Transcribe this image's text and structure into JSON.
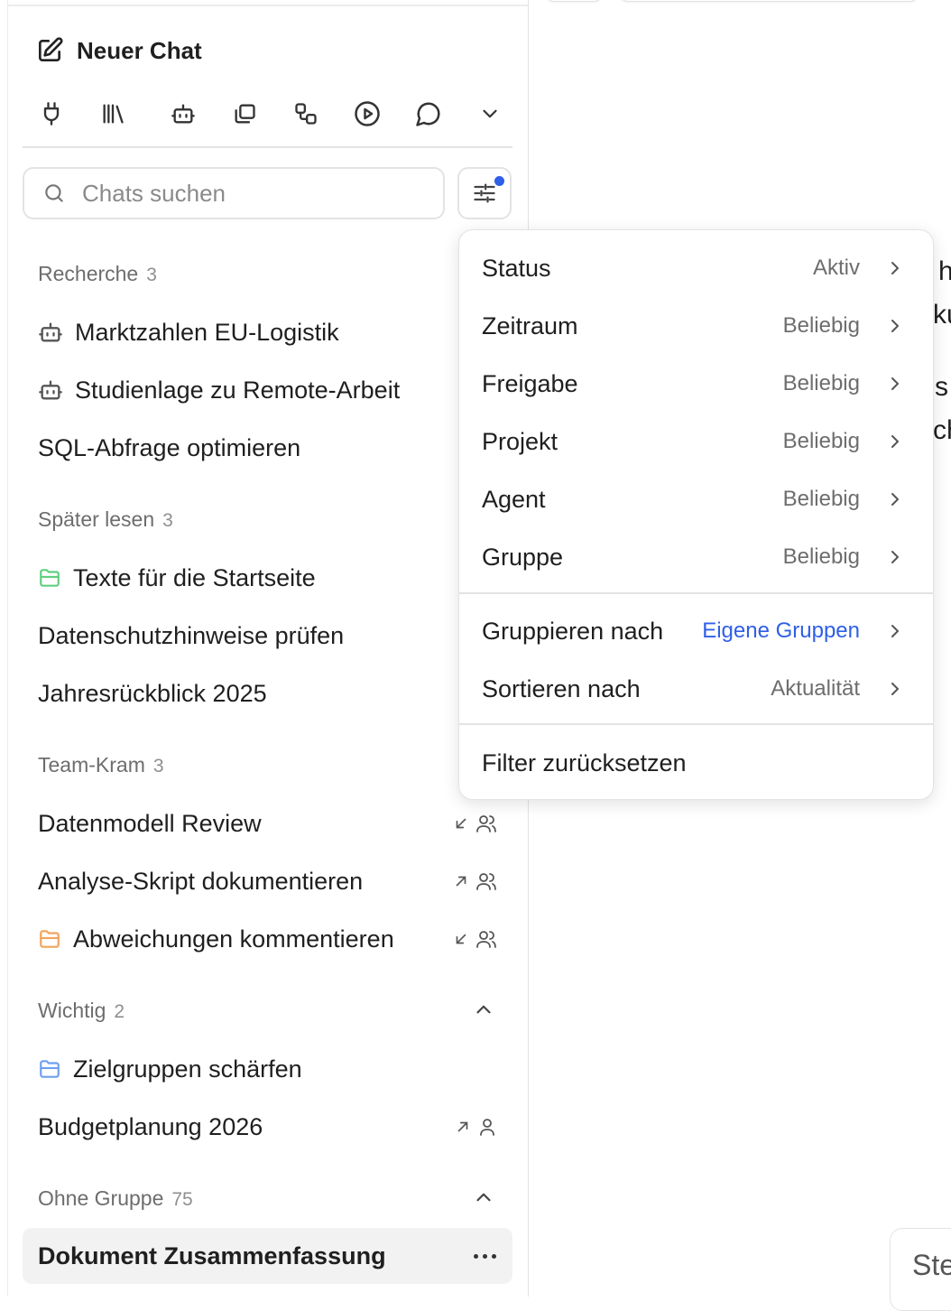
{
  "sidebar": {
    "new_chat": "Neuer Chat",
    "toolbar_icons": [
      "plug-icon",
      "library-icon",
      "bot-icon",
      "copy-icon",
      "workflow-icon",
      "play-icon",
      "message-icon",
      "chevron-down-icon"
    ],
    "search_placeholder": "Chats suchen",
    "groups": [
      {
        "name": "Recherche",
        "count": "3",
        "items": [
          {
            "label": "Marktzahlen EU-Logistik",
            "icon": "bot-icon"
          },
          {
            "label": "Studienlage zu Remote-Arbeit",
            "icon": "bot-icon"
          },
          {
            "label": "SQL-Abfrage optimieren"
          }
        ]
      },
      {
        "name": "Später lesen",
        "count": "3",
        "items": [
          {
            "label": "Texte für die Startseite",
            "icon": "folder-icon",
            "icon_color": "#5fcf7f"
          },
          {
            "label": "Datenschutzhinweise prüfen"
          },
          {
            "label": "Jahresrückblick 2025"
          }
        ]
      },
      {
        "name": "Team-Kram",
        "count": "3",
        "items": [
          {
            "label": "Datenmodell Review",
            "badges": [
              "arrow-down-left-icon",
              "users-icon"
            ]
          },
          {
            "label": "Analyse-Skript dokumentieren",
            "badges": [
              "arrow-up-right-icon",
              "users-icon"
            ]
          },
          {
            "label": "Abweichungen kommentieren",
            "icon": "folder-icon",
            "icon_color": "#f3a35a",
            "badges": [
              "arrow-down-left-icon",
              "users-icon"
            ]
          }
        ]
      },
      {
        "name": "Wichtig",
        "count": "2",
        "items": [
          {
            "label": "Zielgruppen schärfen",
            "icon": "folder-icon",
            "icon_color": "#6f9ff2"
          },
          {
            "label": "Budgetplanung 2026",
            "badges": [
              "arrow-up-right-icon",
              "user-icon"
            ]
          }
        ]
      },
      {
        "name": "Ohne Gruppe",
        "count": "75",
        "items": [
          {
            "label": "Dokument Zusammenfassung",
            "active": true
          }
        ]
      }
    ]
  },
  "filter_menu": {
    "rows": [
      {
        "label": "Status",
        "value": "Aktiv"
      },
      {
        "label": "Zeitraum",
        "value": "Beliebig"
      },
      {
        "label": "Freigabe",
        "value": "Beliebig"
      },
      {
        "label": "Projekt",
        "value": "Beliebig"
      },
      {
        "label": "Agent",
        "value": "Beliebig"
      },
      {
        "label": "Gruppe",
        "value": "Beliebig"
      }
    ],
    "group_by": {
      "label": "Gruppieren nach",
      "value": "Eigene Gruppen"
    },
    "sort_by": {
      "label": "Sortieren nach",
      "value": "Aktualität"
    },
    "reset": "Filter zurücksetzen"
  },
  "background_fragments": [
    "h",
    "ku",
    "s",
    "ch"
  ],
  "bottom_box_text": "Ste",
  "colors": {
    "accent_blue": "#2f5fe8",
    "folder_green": "#5fcf7f",
    "folder_orange": "#f3a35a",
    "folder_blue": "#6f9ff2"
  }
}
